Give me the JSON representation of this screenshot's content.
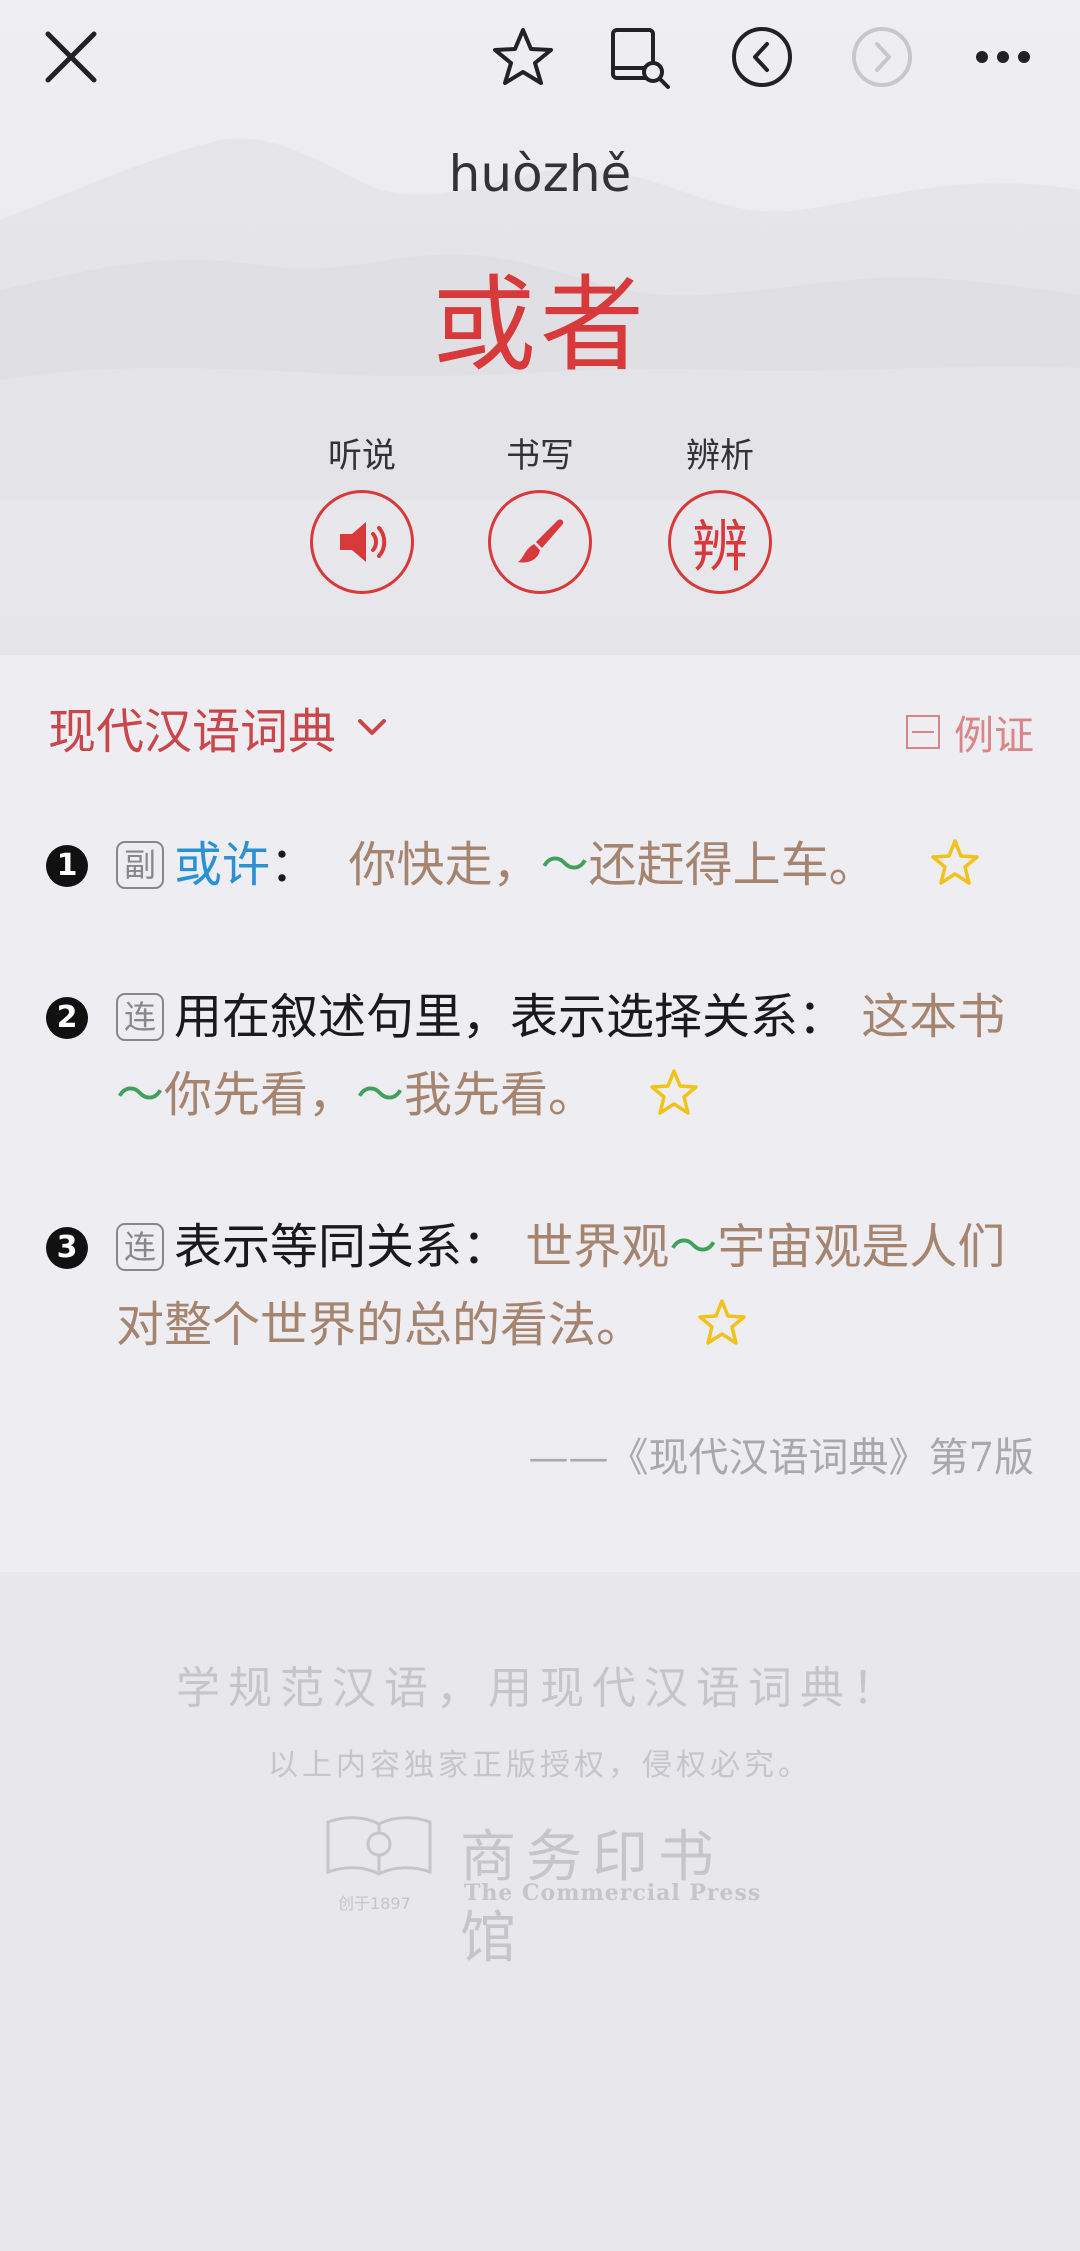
{
  "colors": {
    "accent": "#d8393b",
    "example_text": "#a58470",
    "tilde": "#3fa15a",
    "link": "#2a91d4",
    "star": "#f1c21b"
  },
  "entry": {
    "pinyin": "huòzhě",
    "headword": "或者"
  },
  "actions": [
    {
      "label": "听说",
      "icon": "speaker-icon"
    },
    {
      "label": "书写",
      "icon": "brush-icon"
    },
    {
      "label": "辨析",
      "icon_glyph": "辨"
    }
  ],
  "dictionary": {
    "title": "现代汉语词典",
    "example_toggle": "例证"
  },
  "senses": [
    {
      "num": "1",
      "pos": "副",
      "synonym": "或许",
      "sep": "：",
      "ex_parts": [
        "你快走，",
        "～",
        "还赶得上车。"
      ]
    },
    {
      "num": "2",
      "pos": "连",
      "definition": "用在叙述句里，表示选择关系：",
      "ex_parts": [
        "这本书",
        "～",
        "你先看，",
        "～",
        "我先看。"
      ]
    },
    {
      "num": "3",
      "pos": "连",
      "definition": "表示等同关系：",
      "ex_parts": [
        "世界观",
        "～",
        "宇宙观是人们对整个世界的总的看法。"
      ]
    }
  ],
  "source": "——《现代汉语词典》第7版",
  "footer": {
    "slogan": "学规范汉语，用现代汉语词典！",
    "copyright": "以上内容独家正版授权，侵权必究。",
    "publisher_cn": "商务印书馆",
    "publisher_en": "The Commercial Press",
    "publisher_since": "创于1897"
  }
}
